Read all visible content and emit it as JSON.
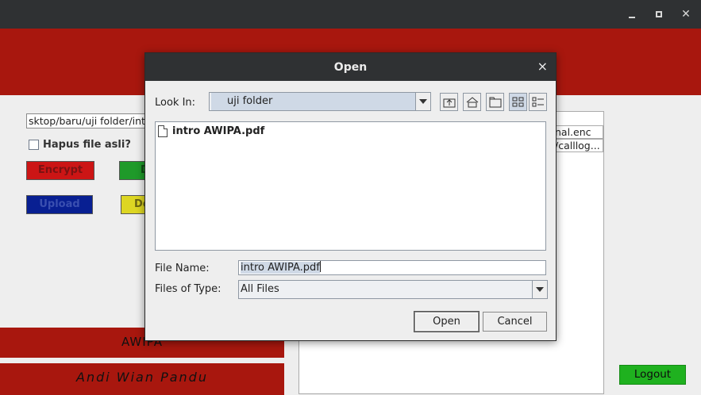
{
  "window": {
    "minimize_glyph": "",
    "maximize_glyph": "",
    "close_glyph": "✕"
  },
  "banner": {
    "title": ""
  },
  "main": {
    "path_value": "sktop/baru/uji folder/int",
    "delete_original_label": "Hapus file asli?",
    "delete_original_checked": false,
    "buttons": {
      "encrypt": "Encrypt",
      "decrypt": "D",
      "upload": "Upload",
      "download": "De"
    },
    "list_items": [
      "nal.enc",
      "/calllog..."
    ],
    "footer": {
      "app_name": "AWIPA",
      "author": "Andi Wian Pandu"
    },
    "logout": "Logout"
  },
  "dialog": {
    "title": "Open",
    "close_glyph": "×",
    "look_in_label": "Look In:",
    "look_in_value": "uji folder",
    "files": [
      {
        "name": "intro AWIPA.pdf"
      }
    ],
    "file_name_label": "File Name:",
    "file_name_value": "intro AWIPA.pdf",
    "files_of_type_label": "Files of Type:",
    "files_of_type_value": "All Files",
    "open_button": "Open",
    "cancel_button": "Cancel",
    "toolbar_icons": [
      "up-folder-icon",
      "home-icon",
      "new-folder-icon",
      "list-view-icon",
      "details-view-icon"
    ]
  }
}
